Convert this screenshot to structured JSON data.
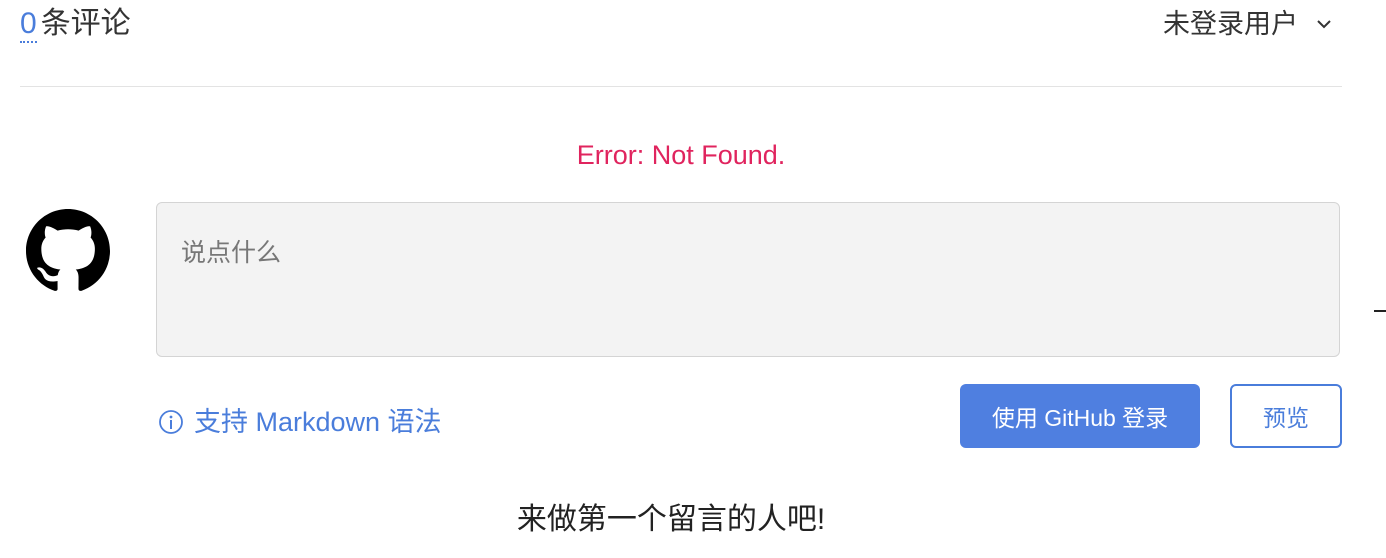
{
  "header": {
    "comment_count": "0",
    "comment_label": "条评论",
    "user_menu_label": "未登录用户"
  },
  "error_message": "Error: Not Found.",
  "editor": {
    "placeholder": "说点什么",
    "markdown_tip": "支持 Markdown 语法",
    "login_button": "使用 GitHub 登录",
    "preview_button": "预览"
  },
  "empty_state": "来做第一个留言的人吧!",
  "colors": {
    "accent": "#4a7ddb",
    "error": "#e0245e",
    "button_bg": "#4f7fe0"
  },
  "icons": {
    "avatar": "github-icon",
    "dropdown": "chevron-down-icon",
    "tip": "info-icon"
  }
}
